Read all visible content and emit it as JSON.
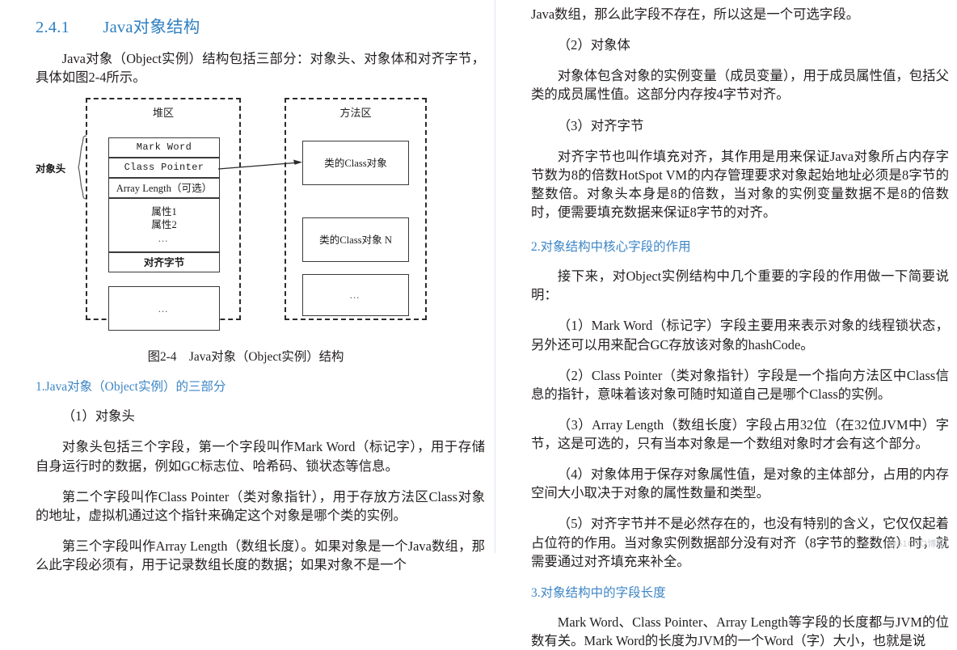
{
  "heading": {
    "number": "2.4.1",
    "title": "Java对象结构"
  },
  "left_column": {
    "intro_paragraph": "Java对象（Object实例）结构包括三部分：对象头、对象体和对齐字节，具体如图2-4所示。",
    "figure": {
      "caption": "图2-4　Java对象（Object实例）结构",
      "heap_region_label": "堆区",
      "method_region_label": "方法区",
      "object_header_label": "对象头",
      "heap_cells": [
        "Mark Word",
        "Class Pointer",
        "Array Length（可选）",
        "属性1",
        "属性2",
        "…",
        "对齐字节",
        "…"
      ],
      "method_cells": [
        "类的Class对象",
        "类的Class对象 N",
        "…"
      ]
    },
    "subheading_1": "1.Java对象（Object实例）的三部分",
    "item_1_title": "（1）对象头",
    "paragraph_header": "对象头包括三个字段，第一个字段叫作Mark Word（标记字），用于存储自身运行时的数据，例如GC标志位、哈希码、锁状态等信息。",
    "paragraph_classptr": "第二个字段叫作Class Pointer（类对象指针），用于存放方法区Class对象的地址，虚拟机通过这个指针来确定这个对象是哪个类的实例。",
    "paragraph_arraylen": "第三个字段叫作Array Length（数组长度）。如果对象是一个Java数组，那么此字段必须有，用于记录数组长度的数据；如果对象不是一个"
  },
  "right_column": {
    "paragraph_arraylen_cont": "Java数组，那么此字段不存在，所以这是一个可选字段。",
    "item_2_title": "（2）对象体",
    "paragraph_body": "对象体包含对象的实例变量（成员变量），用于成员属性值，包括父类的成员属性值。这部分内存按4字节对齐。",
    "item_3_title": "（3）对齐字节",
    "paragraph_padding": "对齐字节也叫作填充对齐，其作用是用来保证Java对象所占内存字节数为8的倍数HotSpot VM的内存管理要求对象起始地址必须是8字节的整数倍。对象头本身是8的倍数，当对象的实例变量数据不是8的倍数时，便需要填充数据来保证8字节的对齐。",
    "subheading_2": "2.对象结构中核心字段的作用",
    "paragraph_intro_fields": "接下来，对Object实例结构中几个重要的字段的作用做一下简要说明：",
    "field_1": "（1）Mark Word（标记字）字段主要用来表示对象的线程锁状态，另外还可以用来配合GC存放该对象的hashCode。",
    "field_2": "（2）Class Pointer（类对象指针）字段是一个指向方法区中Class信息的指针，意味着该对象可随时知道自己是哪个Class的实例。",
    "field_3": "（3）Array Length（数组长度）字段占用32位（在32位JVM中）字节，这是可选的，只有当本对象是一个数组对象时才会有这个部分。",
    "field_4": "（4）对象体用于保存对象属性值，是对象的主体部分，占用的内存空间大小取决于对象的属性数量和类型。",
    "field_5": "（5）对齐字节并不是必然存在的，也没有特别的含义，它仅仅起着占位符的作用。当对象实例数据部分没有对齐（8字节的整数倍）时，就需要通过对齐填充来补全。",
    "subheading_3": "3.对象结构中的字段长度",
    "paragraph_field_length": "Mark Word、Class Pointer、Array Length等字段的长度都与JVM的位数有关。Mark Word的长度为JVM的一个Word（字）大小，也就是说"
  },
  "watermark": "@51CTO博客",
  "colors": {
    "heading_blue": "#2f7fc1",
    "subheading_blue": "#3d86c6",
    "text": "#231f20",
    "divider": "#dfe6ee"
  }
}
